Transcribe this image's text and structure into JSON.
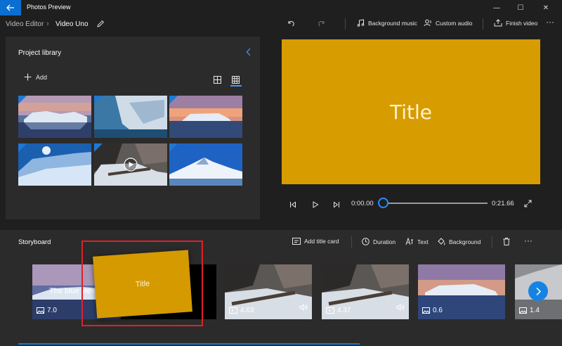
{
  "titlebar": {
    "app_title": "Photos Preview",
    "minimize": "—",
    "maximize": "☐",
    "close": "✕"
  },
  "breadcrumb": {
    "parent": "Video Editor",
    "separator": "›",
    "current": "Video Uno"
  },
  "toolbar": {
    "background_music": "Background music",
    "custom_audio": "Custom audio",
    "finish_video": "Finish video",
    "more": "···"
  },
  "library": {
    "title": "Project library",
    "add_label": "Add"
  },
  "preview": {
    "title_text": "Title",
    "card_color": "#d79c00",
    "current_time": "0:00.00",
    "total_time": "0:21.66",
    "progress": 0
  },
  "storyboard": {
    "title": "Storyboard",
    "add_title_card": "Add title card",
    "duration": "Duration",
    "text": "Text",
    "background": "Background",
    "more": "···",
    "drag_card_text": "Title",
    "clips": [
      {
        "caption": "The blue view",
        "duration": "7.0",
        "kind": "image-icon"
      },
      {
        "caption": "",
        "duration": "",
        "kind": "title-card-black"
      },
      {
        "caption": "",
        "duration": "4.63",
        "kind": "video-icon"
      },
      {
        "caption": "",
        "duration": "4.37",
        "kind": "video-icon"
      },
      {
        "caption": "",
        "duration": "0.6",
        "kind": "image-icon"
      },
      {
        "caption": "",
        "duration": "1.4",
        "kind": "image-icon"
      }
    ]
  }
}
